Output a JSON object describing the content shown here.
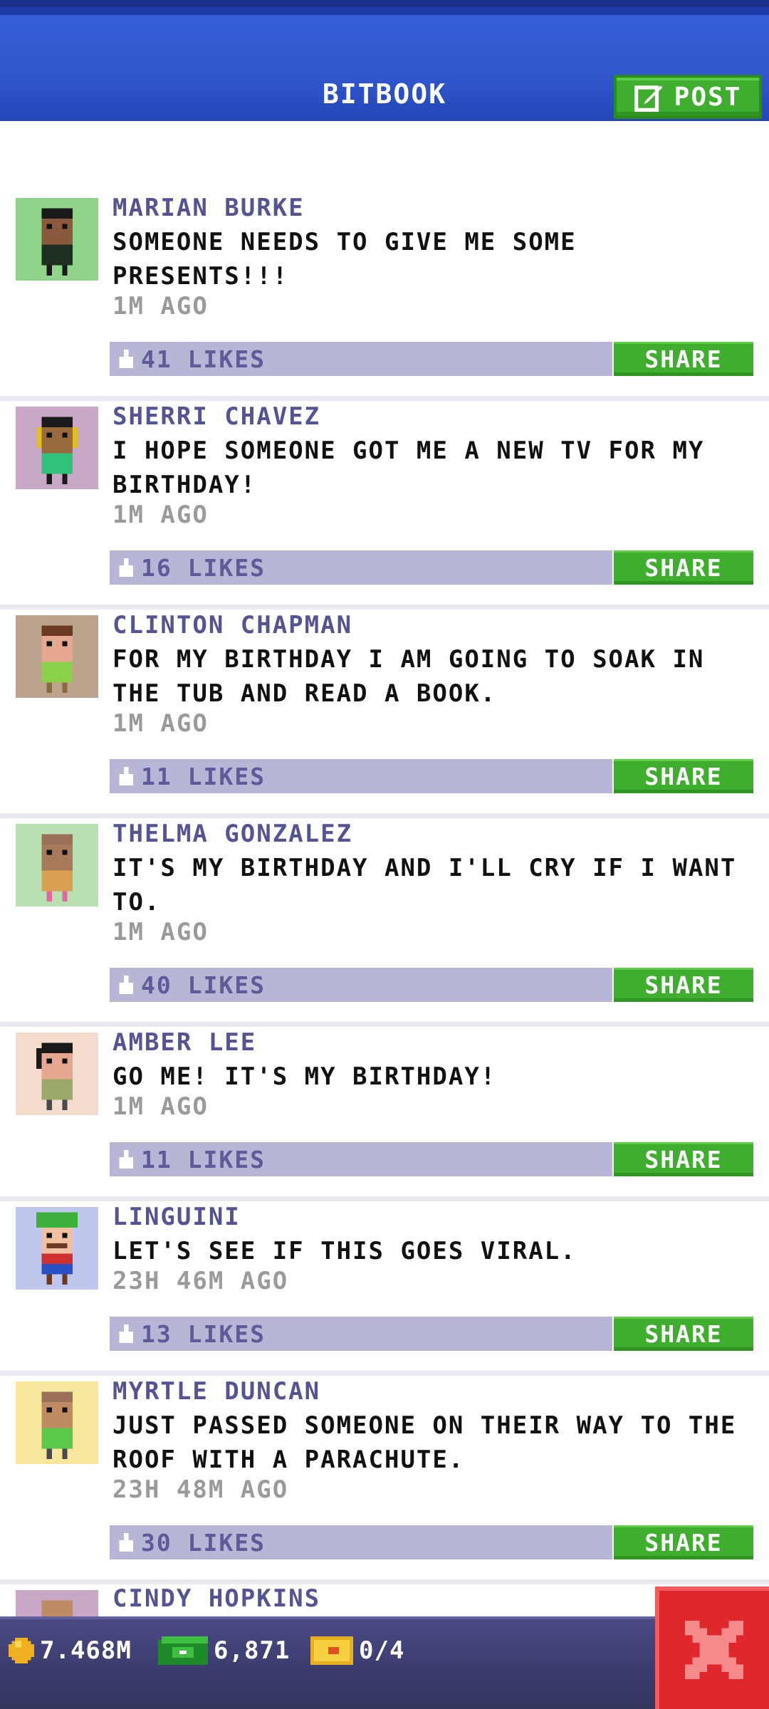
{
  "header": {
    "title": "BITBOOK",
    "post_label": "POST"
  },
  "feed": {
    "posts": [
      {
        "author": "MARIAN BURKE",
        "message": "SOMEONE NEEDS TO GIVE ME SOME PRESENTS!!!",
        "time": "1M AGO",
        "likes": "41 LIKES",
        "share_label": "SHARE",
        "avatar_bg": "#8fd48a"
      },
      {
        "author": "SHERRI CHAVEZ",
        "message": "I HOPE SOMEONE GOT ME A NEW TV FOR MY BIRTHDAY!",
        "time": "1M AGO",
        "likes": "16 LIKES",
        "share_label": "SHARE",
        "avatar_bg": "#c9a7c6"
      },
      {
        "author": "CLINTON CHAPMAN",
        "message": "FOR MY BIRTHDAY I AM GOING TO SOAK IN THE TUB AND READ A BOOK.",
        "time": "1M AGO",
        "likes": "11 LIKES",
        "share_label": "SHARE",
        "avatar_bg": "#bba38d"
      },
      {
        "author": "THELMA GONZALEZ",
        "message": "IT'S MY BIRTHDAY AND I'LL CRY IF I WANT TO.",
        "time": "1M AGO",
        "likes": "40 LIKES",
        "share_label": "SHARE",
        "avatar_bg": "#b9e0b2"
      },
      {
        "author": "AMBER LEE",
        "message": "GO ME! IT'S MY BIRTHDAY!",
        "time": "1M AGO",
        "likes": "11 LIKES",
        "share_label": "SHARE",
        "avatar_bg": "#f3dccd"
      },
      {
        "author": "LINGUINI",
        "message": "LET'S SEE IF THIS GOES VIRAL.",
        "time": "23H 46M AGO",
        "likes": "13 LIKES",
        "share_label": "SHARE",
        "avatar_bg": "#bfc7ee"
      },
      {
        "author": "MYRTLE DUNCAN",
        "message": "JUST PASSED SOMEONE ON THEIR WAY TO THE ROOF WITH A PARACHUTE.",
        "time": "23H 48M AGO",
        "likes": "30 LIKES",
        "share_label": "SHARE",
        "avatar_bg": "#f6e79c"
      }
    ],
    "partial_post": {
      "author": "CINDY HOPKINS",
      "avatar_bg": "#c9a7c6"
    }
  },
  "bottom_bar": {
    "coins": "7.468M",
    "bux": "6,871",
    "tickets": "0/4"
  },
  "colors": {
    "accent_green": "#3fae2e",
    "header_blue": "#2f56cc",
    "like_bar": "#b7b6d6",
    "close_red": "#e0282c"
  }
}
